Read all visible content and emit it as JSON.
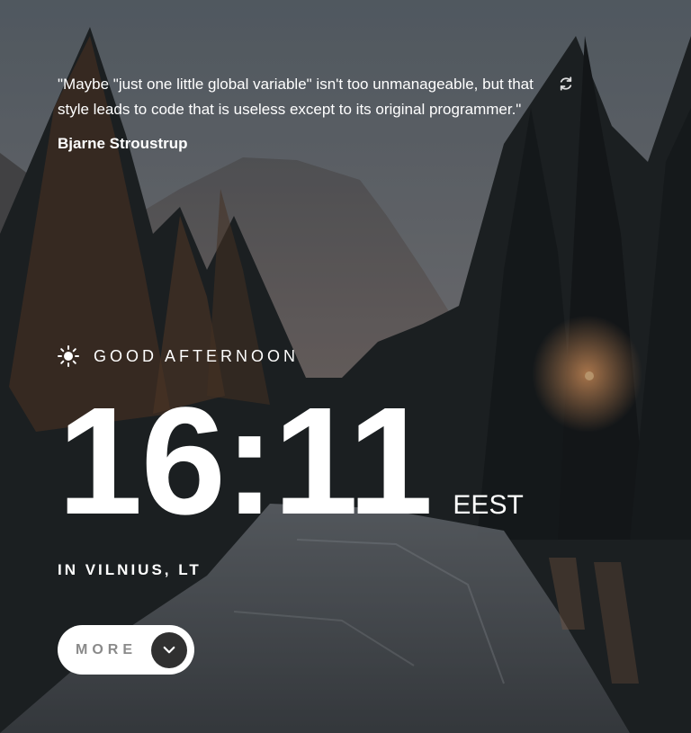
{
  "quote": {
    "text": "\"Maybe \"just one little global variable\" isn't too unmanageable, but that style leads to code that is useless except to its original programmer.\"",
    "author": "Bjarne Stroustrup"
  },
  "greeting": {
    "icon": "sun-icon",
    "text": "Good afternoon"
  },
  "clock": {
    "time": "16:11",
    "timezone": "EEST"
  },
  "location": {
    "text": "In Vilnius, LT"
  },
  "more_button": {
    "label": "More",
    "icon": "chevron-down-icon"
  },
  "refresh_button": {
    "icon": "refresh-icon"
  },
  "colors": {
    "text": "#ffffff",
    "button_bg": "#ffffff",
    "button_label": "#8a8a8a",
    "arrow_circle": "#303030"
  }
}
